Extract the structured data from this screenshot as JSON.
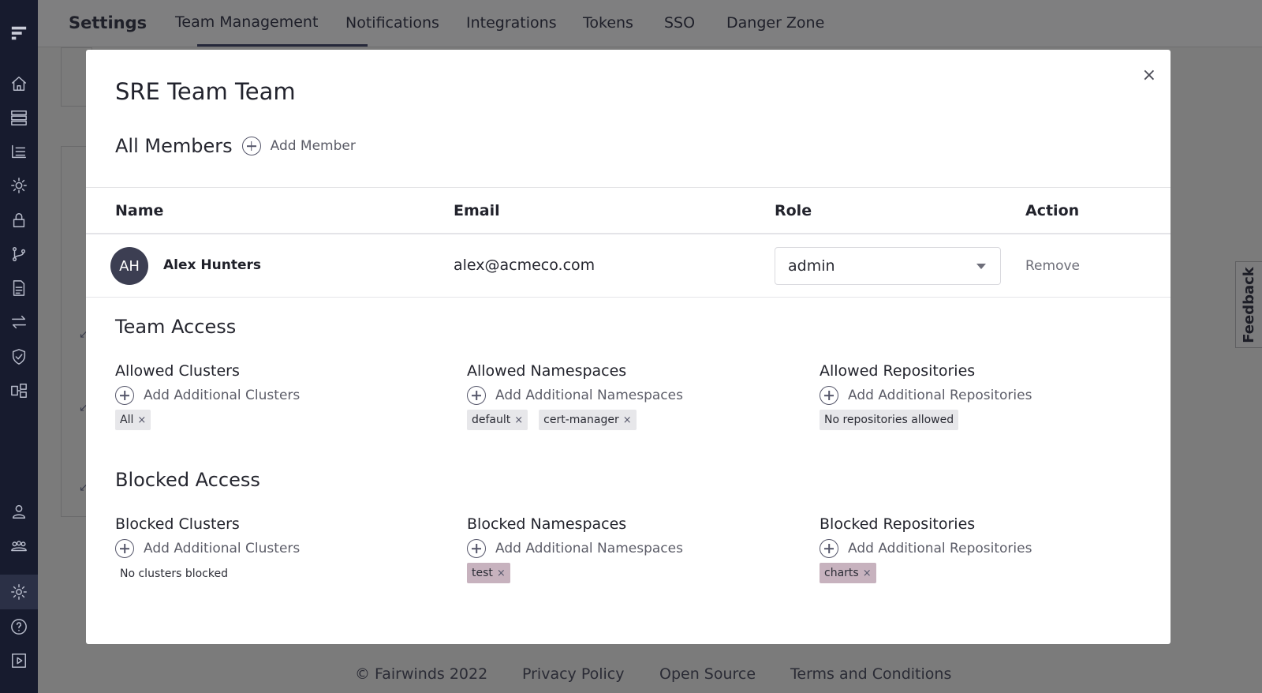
{
  "topbar": {
    "title": "Settings",
    "tabs": [
      "Team Management",
      "Notifications",
      "Integrations",
      "Tokens",
      "SSO",
      "Danger Zone"
    ],
    "active_tab": "Team Management"
  },
  "feedback_label": "Feedback",
  "footer": {
    "copyright": "© Fairwinds 2022",
    "links": [
      "Privacy Policy",
      "Open Source",
      "Terms and Conditions"
    ]
  },
  "modal": {
    "title": "SRE Team Team",
    "close_symbol": "×",
    "members_heading": "All Members",
    "add_member_label": "Add Member",
    "columns": {
      "name": "Name",
      "email": "Email",
      "role": "Role",
      "action": "Action"
    },
    "members": [
      {
        "initials": "AH",
        "name": "Alex Hunters",
        "email": "alex@acmeco.com",
        "role": "admin",
        "action": "Remove"
      }
    ],
    "team_access": {
      "title": "Team Access",
      "clusters": {
        "label": "Allowed Clusters",
        "add": "Add Additional Clusters",
        "chips": [
          "All"
        ]
      },
      "namespaces": {
        "label": "Allowed Namespaces",
        "add": "Add Additional Namespaces",
        "chips": [
          "default",
          "cert-manager"
        ]
      },
      "repositories": {
        "label": "Allowed Repositories",
        "add": "Add Additional Repositories",
        "chips": [
          "No repositories allowed"
        ]
      }
    },
    "blocked_access": {
      "title": "Blocked Access",
      "clusters": {
        "label": "Blocked Clusters",
        "add": "Add Additional Clusters",
        "empty": "No clusters blocked"
      },
      "namespaces": {
        "label": "Blocked Namespaces",
        "add": "Add Additional Namespaces",
        "chips": [
          "test"
        ]
      },
      "repositories": {
        "label": "Blocked Repositories",
        "add": "Add Additional Repositories",
        "chips": [
          "charts"
        ]
      }
    }
  },
  "colors": {
    "sidebar": "#171b2e",
    "overlay": "#7b7b7b",
    "blocked_chip": "#c7b2be",
    "chip": "#e7e7ea"
  }
}
